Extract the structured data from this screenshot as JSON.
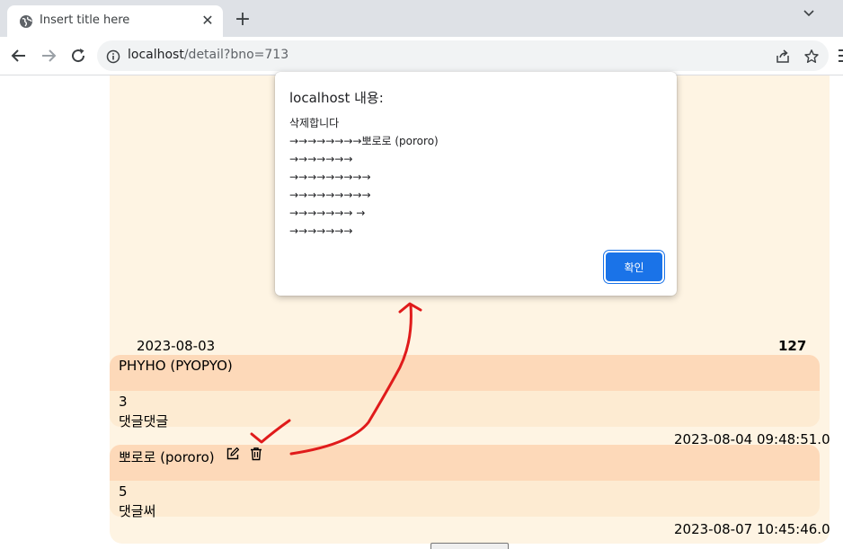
{
  "browser": {
    "tab_title": "Insert title here",
    "url_host": "localhost",
    "url_path": "/detail?bno=713"
  },
  "post": {
    "date": "2023-08-03",
    "count": "127"
  },
  "comments": [
    {
      "author": "PHYHO (PYOPYO)",
      "number": "3",
      "text": "댓글댓글",
      "timestamp": "2023-08-04 09:48:51.0"
    },
    {
      "author": "뽀로로 (pororo)",
      "number": "5",
      "text": "댓글써",
      "timestamp": "2023-08-07 10:45:46.0"
    }
  ],
  "dialog": {
    "title": "localhost 내용:",
    "lines": [
      "삭제합니다",
      "→→→→→→→→뽀로로 (pororo)",
      "→→→→→→→",
      "→→→→→→→→→",
      "→→→→→→→→→",
      "→→→→→→→ →",
      "→→→→→→→"
    ],
    "ok_label": "확인"
  },
  "colors": {
    "board_bg": "#fef4e3",
    "comment_header_bg": "#fdd9b9",
    "comment_body_bg": "#fdebd2",
    "ok_button_bg": "#1a73e8",
    "annotation_red": "#e01b1b"
  }
}
